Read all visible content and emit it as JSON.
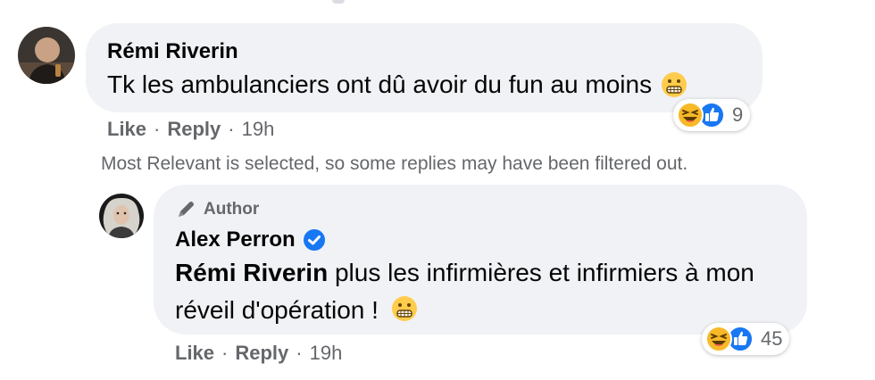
{
  "comment": {
    "author": "Rémi Riverin",
    "text": "Tk les ambulanciers ont dû avoir du fun au moins",
    "emoji": "grimace-emoji",
    "actions": {
      "like": "Like",
      "reply": "Reply",
      "separator": "·",
      "time": "19h"
    },
    "reactions": {
      "count": "9",
      "icons": [
        "haha-reaction-icon",
        "like-reaction-icon"
      ]
    }
  },
  "filter_notice": "Most Relevant is selected, so some replies may have been filtered out.",
  "reply": {
    "badge": "Author",
    "author": "Alex Perron",
    "verified": true,
    "mention": "Rémi Riverin",
    "text": " plus les infirmières et infirmiers à mon réveil d'opération !",
    "emoji": "grimace-emoji",
    "actions": {
      "like": "Like",
      "reply": "Reply",
      "separator": "·",
      "time": "19h"
    },
    "reactions": {
      "count": "45",
      "icons": [
        "haha-reaction-icon",
        "like-reaction-icon"
      ]
    }
  },
  "colors": {
    "bubble_bg": "#f0f2f5",
    "secondary_text": "#65676b",
    "verified_blue": "#1877f2",
    "like_blue": "#1877f2",
    "haha_yellow": "#f7b928"
  }
}
